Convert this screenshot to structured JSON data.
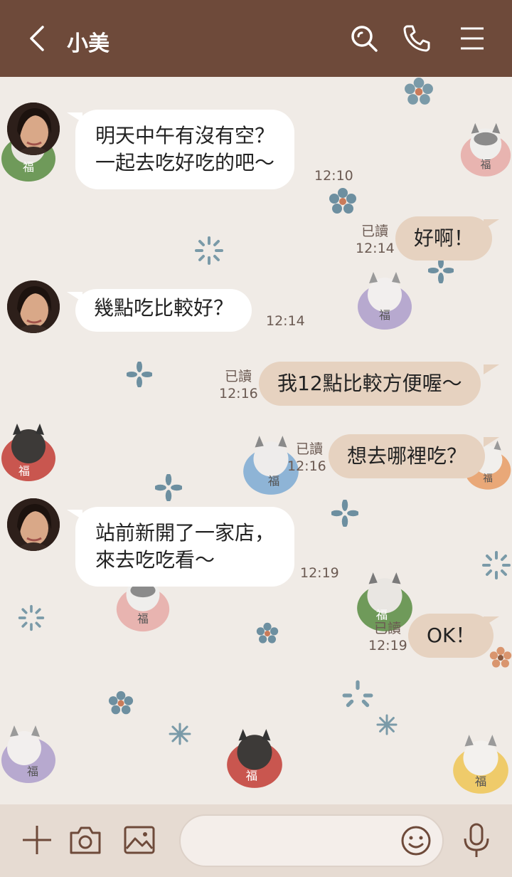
{
  "header": {
    "title": "小美"
  },
  "messages": [
    {
      "text": "明天中午有沒有空？\n一起去吃好吃的吧～",
      "time": "12:10"
    },
    {
      "text": "好啊！",
      "time": "12:14",
      "read": "已讀"
    },
    {
      "text": "幾點吃比較好？",
      "time": "12:14"
    },
    {
      "text": "我12點比較方便喔～",
      "time": "12:16",
      "read": "已讀"
    },
    {
      "text": "想去哪裡吃？",
      "time": "12:16",
      "read": "已讀"
    },
    {
      "text": "站前新開了一家店，\n來去吃吃看～",
      "time": "12:19"
    },
    {
      "text": "OK！",
      "time": "12:19",
      "read": "已讀"
    }
  ],
  "daruma_char": "福",
  "colors": {
    "header": "#6e4a3a",
    "background": "#f0ebe6",
    "out_bubble": "#e6d2c0",
    "in_bubble": "#ffffff",
    "footer": "#e6dbd2",
    "icon": "#6e4a3a"
  },
  "icons": [
    "back-icon",
    "search-icon",
    "phone-icon",
    "menu-icon",
    "plus-icon",
    "camera-icon",
    "image-icon",
    "emoji-icon",
    "mic-icon"
  ]
}
